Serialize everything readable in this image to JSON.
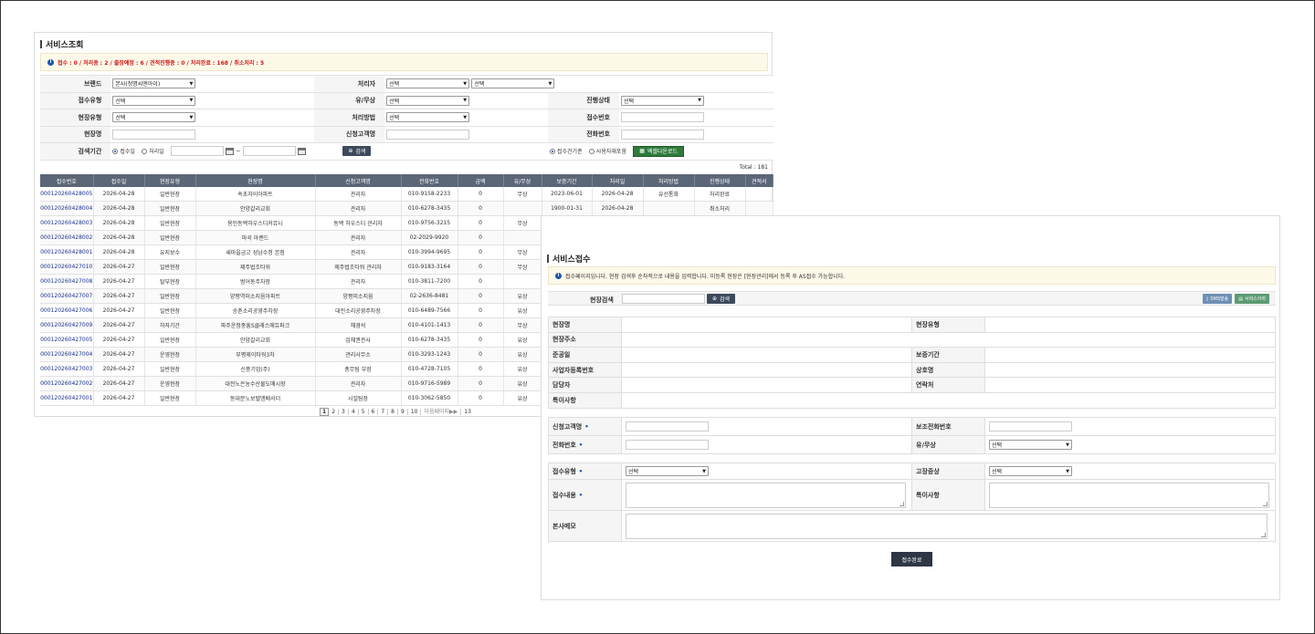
{
  "inquiry": {
    "title": "서비스조회",
    "notice": "접수 : 0 / 처리중 : 2 / 출장예정 : 6 / 견적진행중 : 0 / 처리완료 : 168 / 취소처리 : 5",
    "filters": {
      "brand_label": "브랜드",
      "brand_value": "본사(청명씨엔아이)",
      "handler_label": "처리자",
      "handler_value": "선택",
      "handler_value2": "선택",
      "receipt_type_label": "접수유형",
      "receipt_type_value": "선택",
      "paid_label": "유/무상",
      "paid_value": "선택",
      "progress_label": "진행상태",
      "progress_value": "선택",
      "site_type_label": "현장유형",
      "site_type_value": "선택",
      "method_label": "처리방법",
      "method_value": "선택",
      "receipt_no_label": "접수번호",
      "site_name_label": "현장명",
      "applicant_label": "신청고객명",
      "phone_label": "전화번호",
      "period_label": "검색기간",
      "radio_receipt": "접수일",
      "radio_process": "처리일",
      "search_btn": "검색",
      "radio_case": "접수건기준",
      "radio_parts": "사용자재포함",
      "excel_btn": "엑셀다운로드"
    },
    "total": "Total : 181",
    "columns": [
      "접수번호",
      "접수일",
      "현장유형",
      "현장명",
      "신청고객명",
      "전화번호",
      "금액",
      "유/무상",
      "보증기간",
      "처리일",
      "처리방법",
      "진행상태",
      "견적서"
    ],
    "rows": [
      [
        "000120260428005",
        "2026-04-28",
        "일반현장",
        "속초자이아파트",
        "관리자",
        "010-9158-2233",
        "0",
        "무상",
        "2023-06-01",
        "2026-04-28",
        "유선통화",
        "처리완료",
        ""
      ],
      [
        "000120260428004",
        "2026-04-28",
        "일반현장",
        "안양갈리교회",
        "관리자",
        "010-6278-3435",
        "0",
        "",
        "1900-01-31",
        "2026-04-28",
        "",
        "취소처리",
        ""
      ],
      [
        "000120260428003",
        "2026-04-28",
        "일반현장",
        "용인동백하우스디커뮤니",
        "동백 하우스디 관리자",
        "010-9756-3215",
        "0",
        "무상",
        "",
        "",
        "",
        "",
        ""
      ],
      [
        "000120260428002",
        "2026-04-28",
        "일반현장",
        "마곡 아랜드",
        "관리자",
        "02-2029-9920",
        "0",
        "",
        "",
        "",
        "",
        "",
        ""
      ],
      [
        "000120260428001",
        "2026-04-28",
        "유지보수",
        "새마을금고 성남수정 본점",
        "관리자",
        "010-3994-9695",
        "0",
        "무상",
        "",
        "",
        "",
        "",
        ""
      ],
      [
        "000120260427010",
        "2026-04-27",
        "일반현장",
        "제주법조타워",
        "제주법조타워 관리자",
        "010-9183-3164",
        "0",
        "무상",
        "",
        "",
        "",
        "",
        ""
      ],
      [
        "000120260427008",
        "2026-04-27",
        "탈부현장",
        "범어동주차장",
        "관리자",
        "010-3811-7200",
        "0",
        "",
        "",
        "",
        "",
        "",
        ""
      ],
      [
        "000120260427007",
        "2026-04-27",
        "일반현장",
        "양평역미소지음아파트",
        "양평미소지움",
        "02-2636-8481",
        "0",
        "유상",
        "",
        "",
        "",
        "",
        ""
      ],
      [
        "000120260427006",
        "2026-04-27",
        "일반현장",
        "송촌소리공영주차장",
        "대전소리공영주차장",
        "010-6489-7566",
        "0",
        "유상",
        "",
        "",
        "",
        "",
        ""
      ],
      [
        "000120260427009",
        "2026-04-27",
        "하자기간",
        "파주운정중흥S클래스에듀파크",
        "채경석",
        "010-4101-1413",
        "0",
        "무상",
        "",
        "",
        "",
        "",
        ""
      ],
      [
        "000120260427005",
        "2026-04-27",
        "일반현장",
        "안양갈리교회",
        "임채권관사",
        "010-6278-3435",
        "0",
        "유상",
        "",
        "",
        "",
        "",
        ""
      ],
      [
        "000120260427004",
        "2026-04-27",
        "운영현장",
        "부평제이타워3차",
        "관리사무소",
        "010-3293-1243",
        "0",
        "유상",
        "",
        "",
        "",
        "",
        ""
      ],
      [
        "000120260427003",
        "2026-04-27",
        "일반현장",
        "신풍기업(주)",
        "총무팀 부장",
        "010-4728-7105",
        "0",
        "유상",
        "",
        "",
        "",
        "",
        ""
      ],
      [
        "000120260427002",
        "2026-04-27",
        "운영현장",
        "대전노은농수산물도매시장",
        "관리자",
        "010-9716-5989",
        "0",
        "유상",
        "",
        "",
        "",
        "",
        ""
      ],
      [
        "000120260427001",
        "2026-04-27",
        "일반현장",
        "동대문노보텔앰배서더",
        "시설팀장",
        "010-3062-5850",
        "0",
        "유상",
        "",
        "",
        "",
        "",
        ""
      ]
    ],
    "pages": [
      "1",
      "2",
      "3",
      "4",
      "5",
      "6",
      "7",
      "8",
      "9",
      "10"
    ],
    "next_label": "다음페이지▶▶",
    "last_page": "13"
  },
  "reception": {
    "title": "서비스접수",
    "notice": "접수페이지입니다. 현장 검색후 순차적으로 내용을 입력합니다. 미등록 현장은 [현장관리]에서 등록 후 AS접수 가능합니다.",
    "site_search_label": "현장검색",
    "search_btn": "검색",
    "sms_btn": "SMS발송",
    "history_btn": "서비스이력",
    "site_info": {
      "site_name": "현장명",
      "site_type": "현장유형",
      "site_address": "현장주소",
      "completion": "준공일",
      "warranty": "보증기간",
      "biz_no": "사업자등록번호",
      "company": "상호명",
      "manager": "담당자",
      "contact": "연락처",
      "remarks": "특이사항"
    },
    "customer": {
      "applicant": "신청고객명",
      "sub_phone": "보조전화번호",
      "phone": "전화번호",
      "paid": "유/무상",
      "paid_value": "선택"
    },
    "request": {
      "receipt_type": "접수유형",
      "receipt_type_value": "선택",
      "symptom": "고장증상",
      "symptom_value": "선택",
      "content": "접수내용",
      "remarks": "특이사항",
      "memo": "본사메모"
    },
    "submit_btn": "접수완료"
  },
  "colors": {
    "accent": "#5b6677",
    "alert": "#d01a1a",
    "link": "#1a2f8c",
    "excel": "#2f7a3c"
  }
}
